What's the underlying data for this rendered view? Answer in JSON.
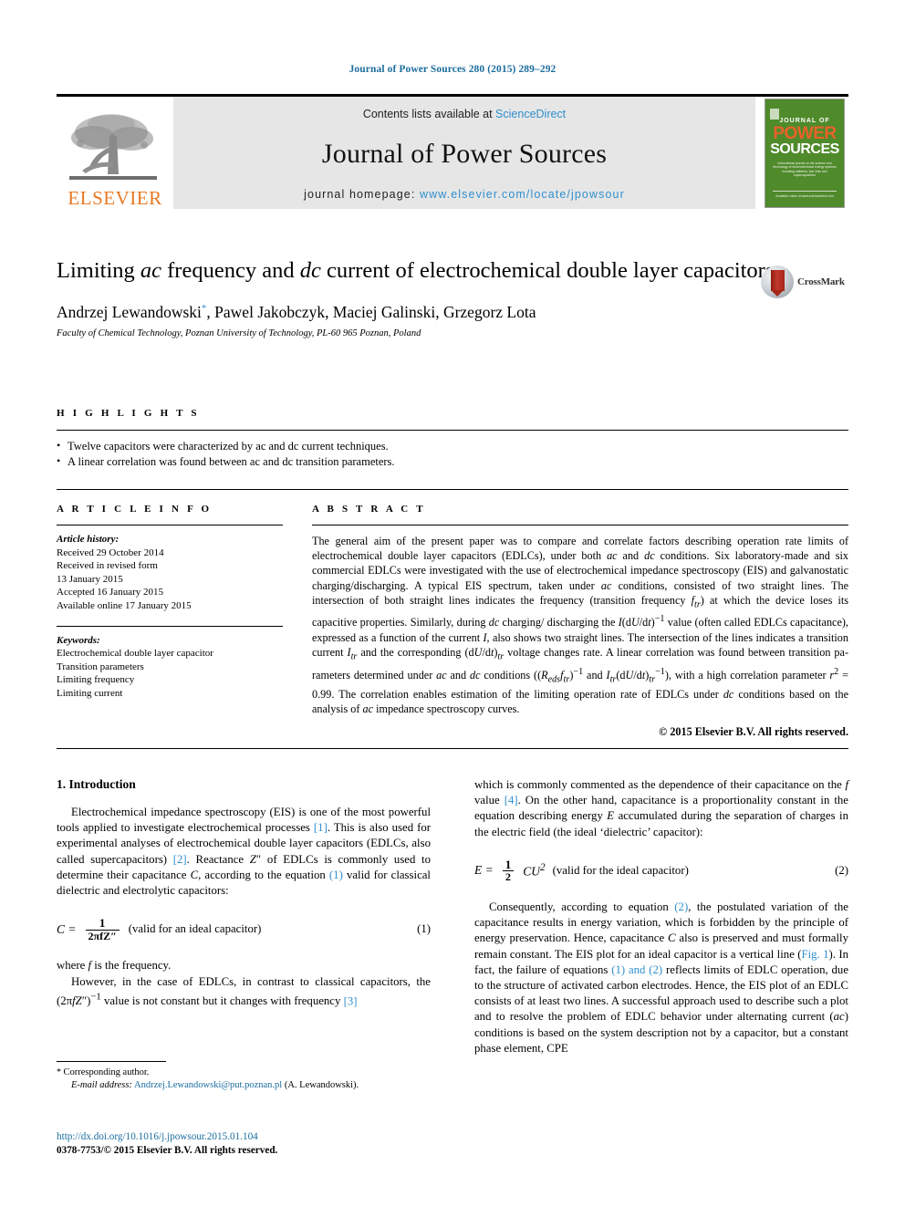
{
  "running_head": "Journal of Power Sources 280 (2015) 289–292",
  "masthead": {
    "contents_prefix": "Contents lists available at ",
    "sciencedirect": "ScienceDirect",
    "journal_name": "Journal of Power Sources",
    "homepage_prefix": "journal homepage: ",
    "homepage_url": "www.elsevier.com/locate/jpowsour",
    "publisher": "ELSEVIER",
    "cover": {
      "journal_of": "JOURNAL OF",
      "power": "POWER",
      "sources": "SOURCES",
      "blurb": "International journal on the science and technology of electrochemical energy systems including batteries, fuel cells and supercapacitors",
      "foot": "Available online at www.sciencedirect.com"
    },
    "colors": {
      "link": "#2f8fce",
      "elsevier_orange": "#E87722",
      "cover_green": "#4f8a2b"
    }
  },
  "article": {
    "title_part1": "Limiting ",
    "title_ac": "ac",
    "title_part2": " frequency and ",
    "title_dc": "dc",
    "title_part3": " current of electrochemical double layer capacitors",
    "crossmark_label": "CrossMark",
    "authors": "Andrzej Lewandowski, Pawel Jakobczyk, Maciej Galinski, Grzegorz Lota",
    "author_marker": "*",
    "affiliation": "Faculty of Chemical Technology, Poznan University of Technology, PL-60 965 Poznan, Poland"
  },
  "highlights": {
    "heading": "H I G H L I G H T S",
    "items": [
      "Twelve capacitors were characterized by ac and dc current techniques.",
      "A linear correlation was found between ac and dc transition parameters."
    ]
  },
  "article_info": {
    "heading": "A R T I C L E  I N F O",
    "history_label": "Article history:",
    "history": [
      "Received 29 October 2014",
      "Received in revised form",
      "13 January 2015",
      "Accepted 16 January 2015",
      "Available online 17 January 2015"
    ],
    "keywords_label": "Keywords:",
    "keywords": [
      "Electrochemical double layer capacitor",
      "Transition parameters",
      "Limiting frequency",
      "Limiting current"
    ]
  },
  "abstract": {
    "heading": "A B S T R A C T",
    "text": "The general aim of the present paper was to compare and correlate factors describing operation rate limits of electrochemical double layer capacitors (EDLCs), under both ac and dc conditions. Six laboratory-made and six commercial EDLCs were investigated with the use of electrochemical impedance spectroscopy (EIS) and galvanostatic charging/discharging. A typical EIS spectrum, taken under ac conditions, consisted of two straight lines. The intersection of both straight lines indicates the frequency (transition frequency ftr) at which the device loses its capacitive properties. Similarly, during dc charging/discharging the I(dU/dt)−1 value (often called EDLCs capacitance), expressed as a function of the current I, also shows two straight lines. The intersection of the lines indicates a transition current Itr and the corresponding (dU/dt)tr voltage changes rate. A linear correlation was found between transition parameters determined under ac and dc conditions ((Redsftr)−1 and Itr(dU/dt)tr−1), with a high correlation parameter r2 = 0.99. The correlation enables estimation of the limiting operation rate of EDLCs under dc conditions based on the analysis of ac impedance spectroscopy curves.",
    "copyright": "© 2015 Elsevier B.V. All rights reserved."
  },
  "body": {
    "section_number_title": "1.  Introduction",
    "left_para_1_a": "Electrochemical impedance spectroscopy (EIS) is one of the most powerful tools applied to investigate electrochemical processes ",
    "ref1": "[1]",
    "left_para_1_b": ". This is also used for experimental analyses of electrochemical double layer capacitors (EDLCs, also called supercapacitors) ",
    "ref2": "[2]",
    "left_para_1_c": ". Reactance Z″ of EDLCs is commonly used to determine their capacitance C, according to the equation ",
    "ref_eq1": "(1)",
    "left_para_1_d": " valid for classical dielectric and electrolytic capacitors:",
    "eq1": {
      "lhs": "C =",
      "num": "1",
      "den": "2πfZ″",
      "note": "(valid for an ideal capacitor)",
      "number": "(1)"
    },
    "left_para_2": "where f is the frequency.",
    "left_para_3_a": "However, in the case of EDLCs, in contrast to classical capacitors, the (2πfZ″)−1 value is not constant but it changes with frequency ",
    "ref3": "[3]",
    "right_para_1_a": "which is commonly commented as the dependence of their capacitance on the f value ",
    "ref4": "[4]",
    "right_para_1_b": ". On the other hand, capacitance is a proportionality constant in the equation describing energy E accumulated during the separation of charges in the electric field (the ideal ‘dielectric’ capacitor):",
    "eq2": {
      "lhs": "E =",
      "num": "1",
      "den": "2",
      "rhs": "CU²",
      "note": "(valid for the ideal capacitor)",
      "number": "(2)"
    },
    "right_para_2_a": "Consequently, according to equation ",
    "ref_eq2": "(2)",
    "right_para_2_b": ", the postulated variation of the capacitance results in energy variation, which is forbidden by the principle of energy preservation. Hence, capacitance C also is preserved and must formally remain constant. The EIS plot for an ideal capacitor is a vertical line (",
    "ref_fig1": "Fig. 1",
    "right_para_2_c": "). In fact, the failure of equations ",
    "ref_eq1and2": "(1) and (2)",
    "right_para_2_d": " reflects limits of EDLC operation, due to the structure of activated carbon electrodes. Hence, the EIS plot of an EDLC consists of at least two lines. A successful approach used to describe such a plot and to resolve the problem of EDLC behavior under alternating current (ac) conditions is based on the system description not by a capacitor, but a constant phase element, CPE"
  },
  "footnote": {
    "corresponding": "Corresponding author.",
    "email_label": "E-mail address:",
    "email": "Andrzej.Lewandowski@put.poznan.pl",
    "email_suffix": "(A. Lewandowski).",
    "doi": "http://dx.doi.org/10.1016/j.jpowsour.2015.01.104",
    "issn_line": "0378-7753/© 2015 Elsevier B.V. All rights reserved."
  }
}
